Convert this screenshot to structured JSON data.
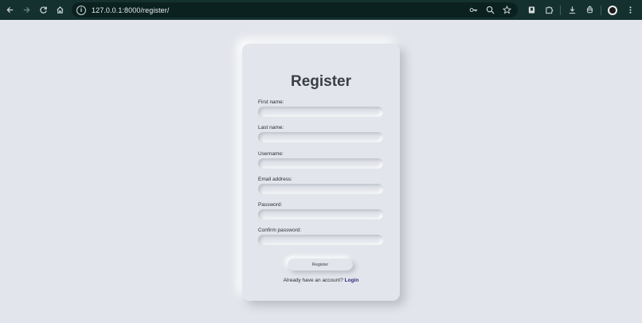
{
  "browser": {
    "url": "127.0.0.1:8000/register/",
    "icons": [
      "back-icon",
      "forward-icon",
      "reload-icon",
      "home-icon",
      "site-info-icon",
      "key-icon",
      "zoom-icon",
      "star-icon",
      "extension-icon",
      "puzzle-icon",
      "download-icon",
      "bug-icon",
      "avatar",
      "menu-icon"
    ]
  },
  "form": {
    "title": "Register",
    "fields": [
      {
        "label": "First name:",
        "value": ""
      },
      {
        "label": "Last name:",
        "value": ""
      },
      {
        "label": "Username:",
        "value": ""
      },
      {
        "label": "Email address:",
        "value": ""
      },
      {
        "label": "Password:",
        "value": ""
      },
      {
        "label": "Confirm password:",
        "value": ""
      }
    ],
    "submit_label": "Register",
    "login_prompt": "Already have an account?",
    "login_link": "Login"
  },
  "colors": {
    "background": "#e2e5eb",
    "chrome": "#14302f",
    "title": "#3a3f47",
    "link": "#2c2f78"
  }
}
